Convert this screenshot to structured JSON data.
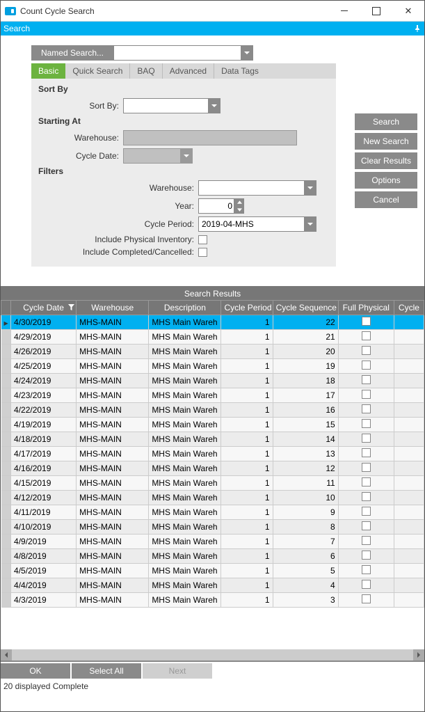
{
  "window": {
    "title": "Count Cycle Search"
  },
  "menubar": {
    "search": "Search"
  },
  "namedSearch": {
    "button": "Named Search...",
    "value": ""
  },
  "tabs": [
    "Basic",
    "Quick Search",
    "BAQ",
    "Advanced",
    "Data Tags"
  ],
  "sortBy": {
    "header": "Sort By",
    "label": "Sort By:",
    "value": ""
  },
  "startingAt": {
    "header": "Starting At",
    "warehouseLabel": "Warehouse:",
    "warehouseValue": "",
    "cycleDateLabel": "Cycle Date:",
    "cycleDateValue": ""
  },
  "filters": {
    "header": "Filters",
    "warehouseLabel": "Warehouse:",
    "warehouseValue": "",
    "yearLabel": "Year:",
    "yearValue": "0",
    "cyclePeriodLabel": "Cycle Period:",
    "cyclePeriodValue": "2019-04-MHS",
    "includePhysLabel": "Include Physical Inventory:",
    "includeCompLabel": "Include Completed/Cancelled:"
  },
  "sideButtons": [
    "Search",
    "New Search",
    "Clear Results",
    "Options",
    "Cancel"
  ],
  "results": {
    "title": "Search Results",
    "cols": [
      "Cycle Date",
      "Warehouse",
      "Description",
      "Cycle Period",
      "Cycle Sequence",
      "Full Physical",
      "Cycle"
    ],
    "rows": [
      {
        "date": "4/30/2019",
        "wh": "MHS-MAIN",
        "desc": "MHS Main Wareh",
        "per": "1",
        "seq": "22",
        "phys": false,
        "sel": true
      },
      {
        "date": "4/29/2019",
        "wh": "MHS-MAIN",
        "desc": "MHS Main Wareh",
        "per": "1",
        "seq": "21",
        "phys": false
      },
      {
        "date": "4/26/2019",
        "wh": "MHS-MAIN",
        "desc": "MHS Main Wareh",
        "per": "1",
        "seq": "20",
        "phys": false
      },
      {
        "date": "4/25/2019",
        "wh": "MHS-MAIN",
        "desc": "MHS Main Wareh",
        "per": "1",
        "seq": "19",
        "phys": false
      },
      {
        "date": "4/24/2019",
        "wh": "MHS-MAIN",
        "desc": "MHS Main Wareh",
        "per": "1",
        "seq": "18",
        "phys": false
      },
      {
        "date": "4/23/2019",
        "wh": "MHS-MAIN",
        "desc": "MHS Main Wareh",
        "per": "1",
        "seq": "17",
        "phys": false
      },
      {
        "date": "4/22/2019",
        "wh": "MHS-MAIN",
        "desc": "MHS Main Wareh",
        "per": "1",
        "seq": "16",
        "phys": false
      },
      {
        "date": "4/19/2019",
        "wh": "MHS-MAIN",
        "desc": "MHS Main Wareh",
        "per": "1",
        "seq": "15",
        "phys": false
      },
      {
        "date": "4/18/2019",
        "wh": "MHS-MAIN",
        "desc": "MHS Main Wareh",
        "per": "1",
        "seq": "14",
        "phys": false
      },
      {
        "date": "4/17/2019",
        "wh": "MHS-MAIN",
        "desc": "MHS Main Wareh",
        "per": "1",
        "seq": "13",
        "phys": false
      },
      {
        "date": "4/16/2019",
        "wh": "MHS-MAIN",
        "desc": "MHS Main Wareh",
        "per": "1",
        "seq": "12",
        "phys": false
      },
      {
        "date": "4/15/2019",
        "wh": "MHS-MAIN",
        "desc": "MHS Main Wareh",
        "per": "1",
        "seq": "11",
        "phys": false
      },
      {
        "date": "4/12/2019",
        "wh": "MHS-MAIN",
        "desc": "MHS Main Wareh",
        "per": "1",
        "seq": "10",
        "phys": false
      },
      {
        "date": "4/11/2019",
        "wh": "MHS-MAIN",
        "desc": "MHS Main Wareh",
        "per": "1",
        "seq": "9",
        "phys": false
      },
      {
        "date": "4/10/2019",
        "wh": "MHS-MAIN",
        "desc": "MHS Main Wareh",
        "per": "1",
        "seq": "8",
        "phys": false
      },
      {
        "date": "4/9/2019",
        "wh": "MHS-MAIN",
        "desc": "MHS Main Wareh",
        "per": "1",
        "seq": "7",
        "phys": false
      },
      {
        "date": "4/8/2019",
        "wh": "MHS-MAIN",
        "desc": "MHS Main Wareh",
        "per": "1",
        "seq": "6",
        "phys": false
      },
      {
        "date": "4/5/2019",
        "wh": "MHS-MAIN",
        "desc": "MHS Main Wareh",
        "per": "1",
        "seq": "5",
        "phys": false
      },
      {
        "date": "4/4/2019",
        "wh": "MHS-MAIN",
        "desc": "MHS Main Wareh",
        "per": "1",
        "seq": "4",
        "phys": false
      },
      {
        "date": "4/3/2019",
        "wh": "MHS-MAIN",
        "desc": "MHS Main Wareh",
        "per": "1",
        "seq": "3",
        "phys": false
      }
    ]
  },
  "footer": {
    "ok": "OK",
    "selectAll": "Select All",
    "next": "Next"
  },
  "status": "20 displayed Complete"
}
